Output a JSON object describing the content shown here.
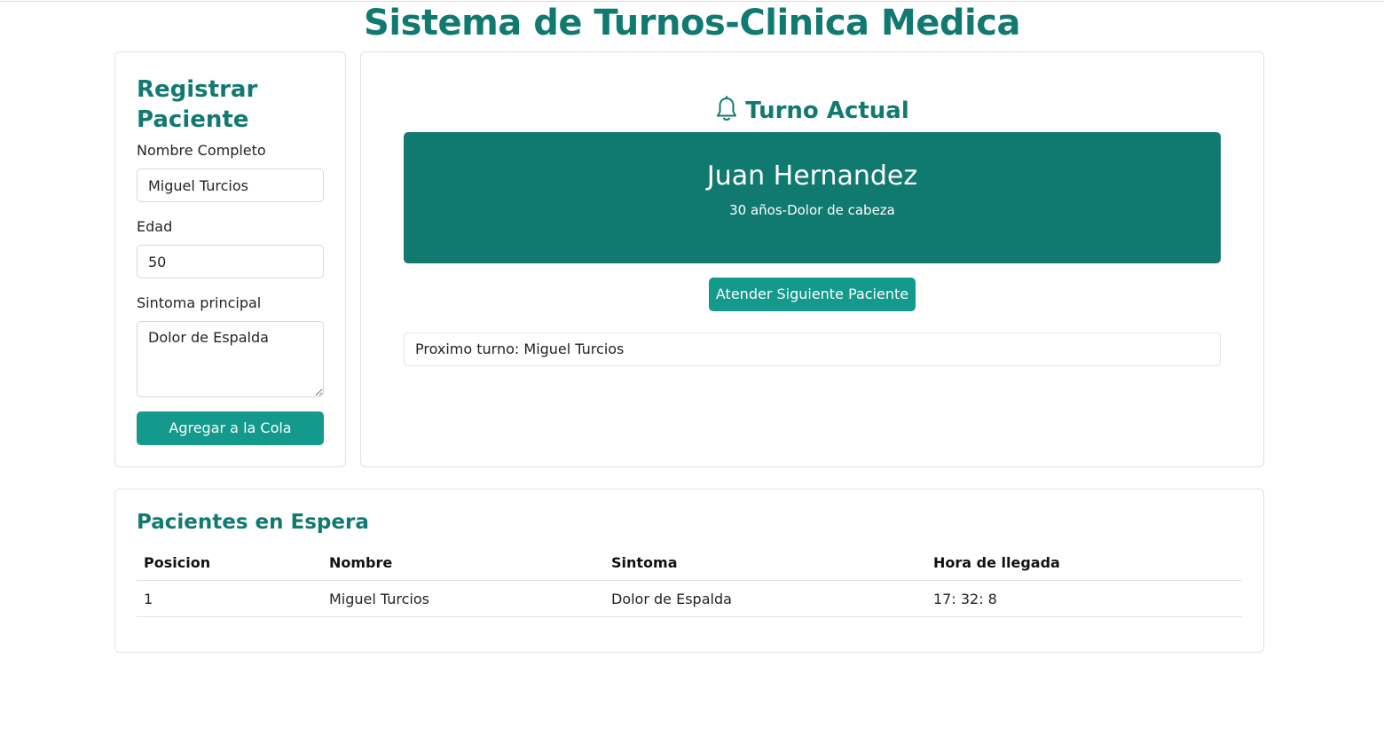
{
  "page": {
    "title": "Sistema de Turnos-Clinica Medica"
  },
  "register": {
    "heading": "Registrar Paciente",
    "name_label": "Nombre Completo",
    "name_value": "Miguel Turcios",
    "age_label": "Edad",
    "age_value": "50",
    "symptom_label": "Sintoma principal",
    "symptom_value": "Dolor de Espalda",
    "add_button": "Agregar a la Cola"
  },
  "current": {
    "heading": "Turno Actual",
    "heading_icon": "bell-icon",
    "patient_name": "Juan Hernandez",
    "patient_details": "30 años-Dolor de cabeza",
    "next_button": "Atender Siguiente Paciente",
    "next_turn_text": "Proximo turno: Miguel Turcios"
  },
  "queue": {
    "heading": "Pacientes en Espera",
    "columns": [
      "Posicion",
      "Nombre",
      "Sintoma",
      "Hora de llegada"
    ],
    "rows": [
      {
        "position": "1",
        "name": "Miguel Turcios",
        "symptom": "Dolor de Espalda",
        "arrival": "17: 32: 8"
      }
    ]
  },
  "colors": {
    "primary": "#117a70",
    "button": "#139a8c",
    "border": "#dfe2e5"
  }
}
